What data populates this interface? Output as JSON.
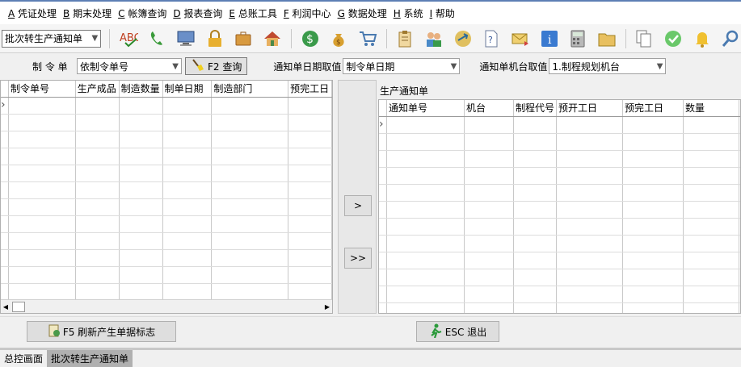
{
  "menu": [
    {
      "key": "A",
      "label": " 凭证处理"
    },
    {
      "key": "B",
      "label": " 期末处理"
    },
    {
      "key": "C",
      "label": " 帐簿查询"
    },
    {
      "key": "D",
      "label": " 报表查询"
    },
    {
      "key": "E",
      "label": " 总账工具"
    },
    {
      "key": "F",
      "label": " 利润中心"
    },
    {
      "key": "G",
      "label": " 数据处理"
    },
    {
      "key": "H",
      "label": " 系统"
    },
    {
      "key": "I",
      "label": " 帮助"
    }
  ],
  "toolbar": {
    "select_value": "批次转生产通知单",
    "icons": [
      "spellcheck-icon",
      "phone-icon",
      "monitor-icon",
      "lock-icon",
      "briefcase-icon",
      "home-icon",
      "dollar-icon",
      "money-bag-icon",
      "cart-icon",
      "clipboard-icon",
      "users-icon",
      "transfer-icon",
      "help-doc-icon",
      "mail-icon",
      "info-icon",
      "calculator-icon",
      "folder-icon",
      "copy-icon",
      "check-icon",
      "bell-icon",
      "search-icon"
    ]
  },
  "filter": {
    "order_label": "制  令  单",
    "order_value": "依制令单号",
    "query_label": "F2 查询",
    "date_label": "通知单日期取值",
    "date_value": "制令单日期",
    "machine_label": "通知单机台取值",
    "machine_value": "1.制程规划机台"
  },
  "left_grid": {
    "columns": [
      "制令单号",
      "生产成品",
      "制造数量",
      "制单日期",
      "制造部门",
      "预完工日"
    ]
  },
  "right_grid": {
    "title": "生产通知单",
    "columns": [
      "通知单号",
      "机台",
      "制程代号",
      "预开工日",
      "预完工日",
      "数量"
    ]
  },
  "middle": {
    "move_one": ">",
    "move_all": ">>"
  },
  "bottom": {
    "refresh_label": "F5 刷新产生单据标志",
    "exit_label": "ESC 退出"
  },
  "status_tabs": [
    "总控画面",
    "批次转生产通知单"
  ]
}
